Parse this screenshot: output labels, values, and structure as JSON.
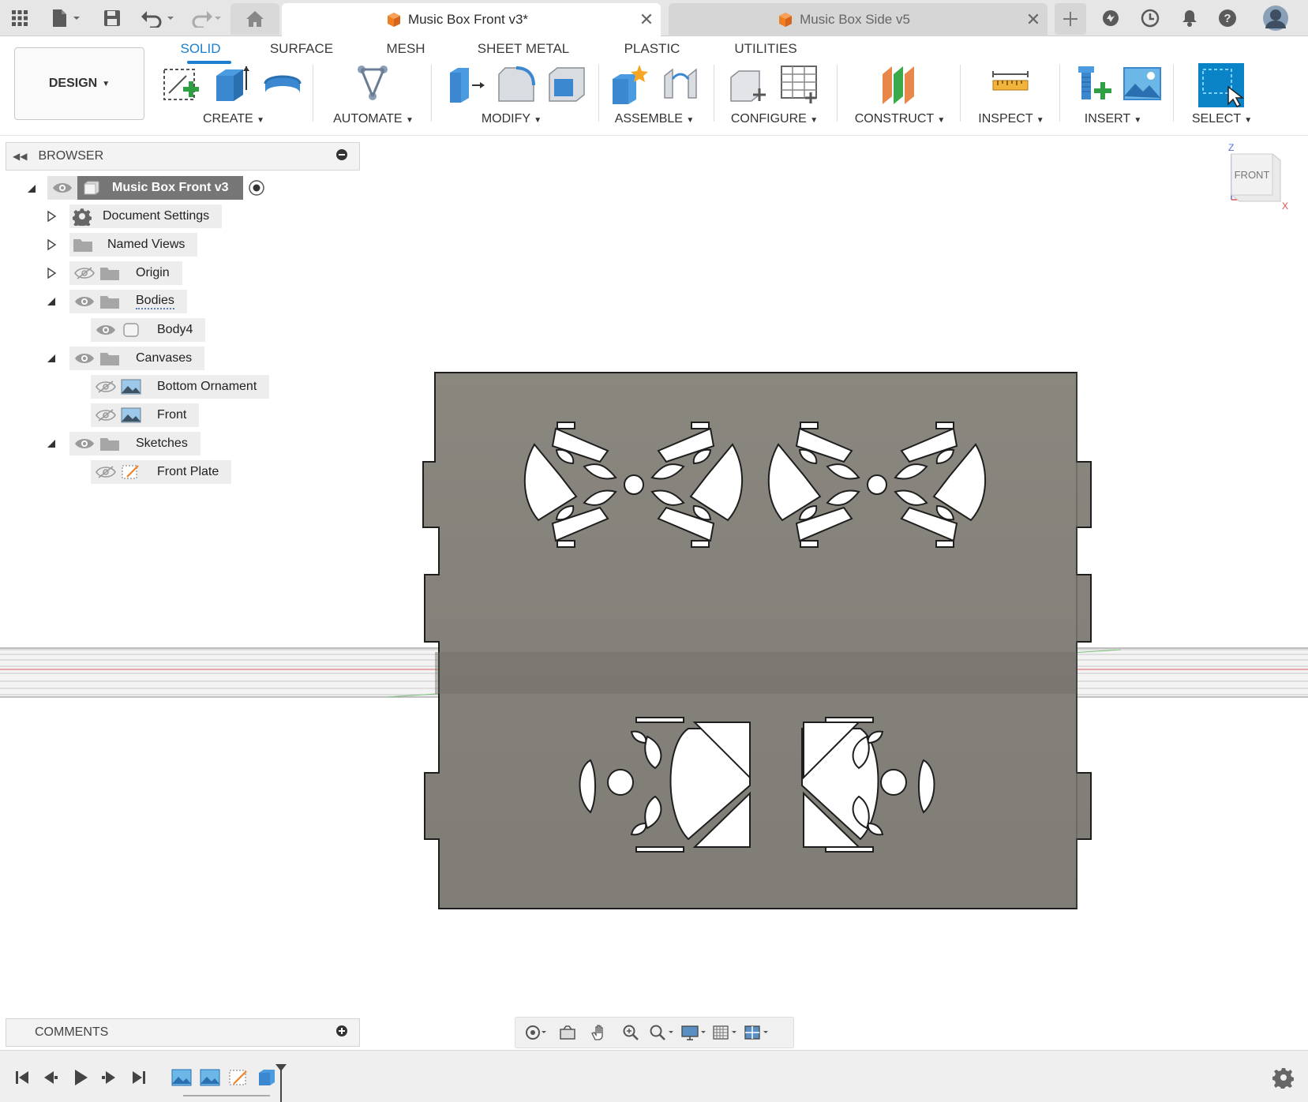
{
  "tabs": [
    {
      "title": "Music Box Front v3*",
      "active": true
    },
    {
      "title": "Music Box Side v5",
      "active": false
    }
  ],
  "topbar_icons": [
    "grid-icon",
    "file-icon",
    "save-icon",
    "undo-icon",
    "redo-icon",
    "home-icon",
    "new-tab-icon",
    "extensions-icon",
    "job-status-icon",
    "notifications-icon",
    "help-icon",
    "user-avatar"
  ],
  "design_button": "DESIGN",
  "workspace_tabs": [
    "SOLID",
    "SURFACE",
    "MESH",
    "SHEET METAL",
    "PLASTIC",
    "UTILITIES"
  ],
  "active_workspace_tab": "SOLID",
  "tool_groups": [
    "CREATE",
    "AUTOMATE",
    "MODIFY",
    "ASSEMBLE",
    "CONFIGURE",
    "CONSTRUCT",
    "INSPECT",
    "INSERT",
    "SELECT"
  ],
  "browser": {
    "title": "BROWSER",
    "root": "Music Box Front v3",
    "items": [
      {
        "label": "Document Settings"
      },
      {
        "label": "Named Views"
      },
      {
        "label": "Origin"
      },
      {
        "label": "Bodies"
      },
      {
        "label": "Body4"
      },
      {
        "label": "Canvases"
      },
      {
        "label": "Bottom Ornament"
      },
      {
        "label": "Front"
      },
      {
        "label": "Sketches"
      },
      {
        "label": "Front Plate"
      }
    ]
  },
  "viewcube": {
    "face": "FRONT",
    "axis_z": "Z",
    "axis_x": "X"
  },
  "comments": {
    "title": "COMMENTS"
  },
  "colors": {
    "accent": "#1a7fd1",
    "body": "#858279",
    "body_dark": "#1e1e1e",
    "select_blue": "#0a84c6",
    "orange": "#f07f22"
  }
}
